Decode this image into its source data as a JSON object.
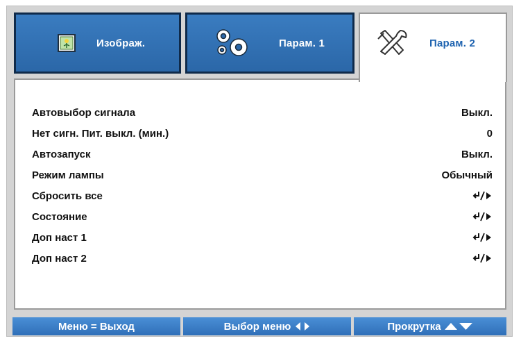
{
  "tabs": [
    {
      "label": "Изображ.",
      "icon": "image-icon",
      "active": false
    },
    {
      "label": "Парам. 1",
      "icon": "gears-icon",
      "active": false
    },
    {
      "label": "Парам. 2",
      "icon": "tools-icon",
      "active": true
    }
  ],
  "menu": {
    "items": [
      {
        "label": "Автовыбор сигнала",
        "value": "Выкл."
      },
      {
        "label": "Нет сигн. Пит. выкл. (мин.)",
        "value": "0"
      },
      {
        "label": "Автозапуск",
        "value": "Выкл."
      },
      {
        "label": "Режим лампы",
        "value": "Обычный"
      },
      {
        "label": "Сбросить все",
        "value": "enter-submenu-icon"
      },
      {
        "label": "Состояние",
        "value": "enter-submenu-icon"
      },
      {
        "label": "Доп наст 1",
        "value": "enter-submenu-icon"
      },
      {
        "label": "Доп наст 2",
        "value": "enter-submenu-icon"
      }
    ]
  },
  "footer": {
    "exit": "Меню = Выход",
    "select": "Выбор меню",
    "scroll": "Прокрутка"
  },
  "colors": {
    "tab_blue": "#2f6fb8",
    "active_tab_text": "#1e63b0",
    "panel_gray": "#d4d4d4"
  }
}
